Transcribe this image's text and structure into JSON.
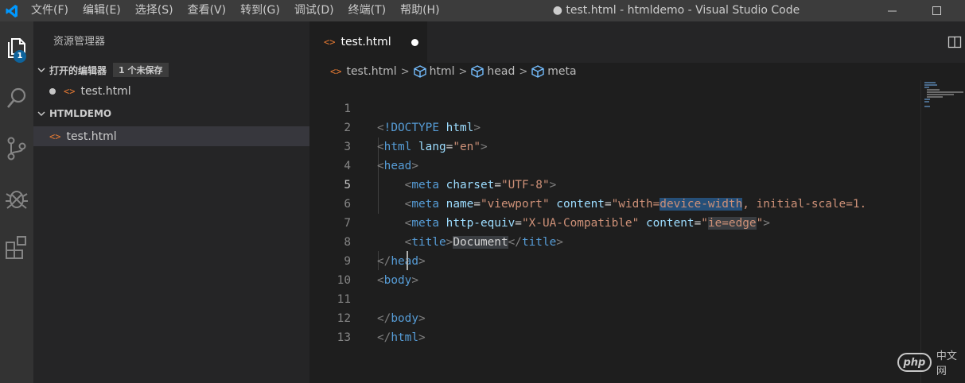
{
  "titlebar": {
    "menus": [
      "文件(F)",
      "编辑(E)",
      "选择(S)",
      "查看(V)",
      "转到(G)",
      "调试(D)",
      "终端(T)",
      "帮助(H)"
    ],
    "window_title": "● test.html - htmldemo - Visual Studio Code"
  },
  "activity": {
    "explorer_badge": "1",
    "icons": [
      "files-icon",
      "search-icon",
      "source-control-icon",
      "debug-icon",
      "extensions-icon"
    ]
  },
  "sidebar": {
    "title": "资源管理器",
    "open_editors": {
      "header": "打开的编辑器",
      "badge": "1 个未保存",
      "files": [
        {
          "name": "test.html",
          "dirty": true
        }
      ]
    },
    "folder": {
      "header": "HTMLDEMO",
      "files": [
        {
          "name": "test.html"
        }
      ]
    }
  },
  "editor": {
    "tab": {
      "label": "test.html",
      "dirty": true
    },
    "breadcrumb": [
      "test.html",
      "html",
      "head",
      "meta"
    ],
    "current_line": 5,
    "lines": [
      {
        "n": "1"
      },
      {
        "n": "2"
      },
      {
        "n": "3"
      },
      {
        "n": "4"
      },
      {
        "n": "5"
      },
      {
        "n": "6"
      },
      {
        "n": "7"
      },
      {
        "n": "8"
      },
      {
        "n": "9"
      },
      {
        "n": "10"
      },
      {
        "n": "11"
      },
      {
        "n": "12"
      },
      {
        "n": "13"
      }
    ],
    "code": {
      "l1_doctype": "!DOCTYPE",
      "l1_html": "html",
      "l2_tag": "html",
      "l2_attr": "lang",
      "l2_val": "\"en\"",
      "l3_tag": "head",
      "l4_tag": "meta",
      "l4_attr": "charset",
      "l4_val": "\"UTF-8\"",
      "l5_tag": "meta",
      "l5_attr1": "name",
      "l5_val1": "\"viewport\"",
      "l5_attr2": "content",
      "l5_val2a": "\"width=",
      "l5_val2b": "device-width",
      "l5_val2c": ", initial-scale=1.",
      "l6_tag": "meta",
      "l6_attr1": "http-equiv",
      "l6_val1": "\"X-UA-Compatible\"",
      "l6_attr2": "content",
      "l6_val2a": "\"",
      "l6_val2b": "ie=edge",
      "l6_val2c": "\"",
      "l7_tag": "title",
      "l7_text": "Document",
      "l7_close": "title",
      "l8_tag": "head",
      "l9_tag": "body",
      "l11_tag": "body",
      "l12_tag": "html"
    }
  },
  "watermark": {
    "logo": "php",
    "text": "中文网"
  },
  "colors": {
    "tag": "#569cd6",
    "attr": "#9cdcfe",
    "string": "#ce9178",
    "punct": "#808080",
    "html_icon": "#e37933",
    "badge": "#0e639c"
  }
}
